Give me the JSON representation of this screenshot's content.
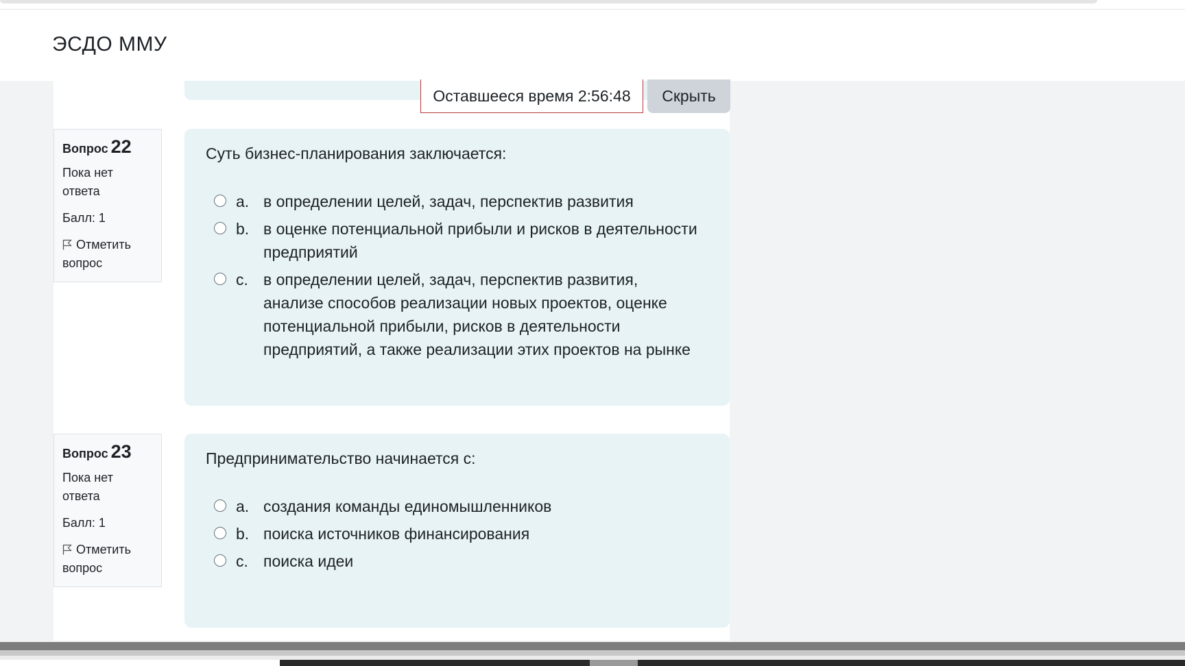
{
  "site": {
    "brand": "ЭСДО ММУ"
  },
  "timer": {
    "label": "Оставшееся время",
    "value": "2:56:48",
    "hide_label": "Скрыть"
  },
  "questions": [
    {
      "label": "Вопрос",
      "number": "22",
      "state": "Пока нет ответа",
      "grade": "Балл: 1",
      "flag_label": "Отметить вопрос",
      "text": "Суть бизнес-планирования заключается:",
      "answers": [
        {
          "letter": "a.",
          "text": "в определении целей, задач, перспектив развития"
        },
        {
          "letter": "b.",
          "text": "в оценке потенциальной прибыли и рисков в деятельности предприятий"
        },
        {
          "letter": "c.",
          "text": "в определении целей, задач, перспектив развития, анализе способов реализации новых проектов, оценке потенциальной прибыли, рисков в деятельности предприятий, а также реализации этих проектов на рынке"
        }
      ]
    },
    {
      "label": "Вопрос",
      "number": "23",
      "state": "Пока нет ответа",
      "grade": "Балл: 1",
      "flag_label": "Отметить вопрос",
      "text": "Предпринимательство начинается с:",
      "answers": [
        {
          "letter": "a.",
          "text": "создания команды единомышленников"
        },
        {
          "letter": "b.",
          "text": "поиска источников финансирования"
        },
        {
          "letter": "c.",
          "text": "поиска идеи"
        }
      ]
    }
  ]
}
